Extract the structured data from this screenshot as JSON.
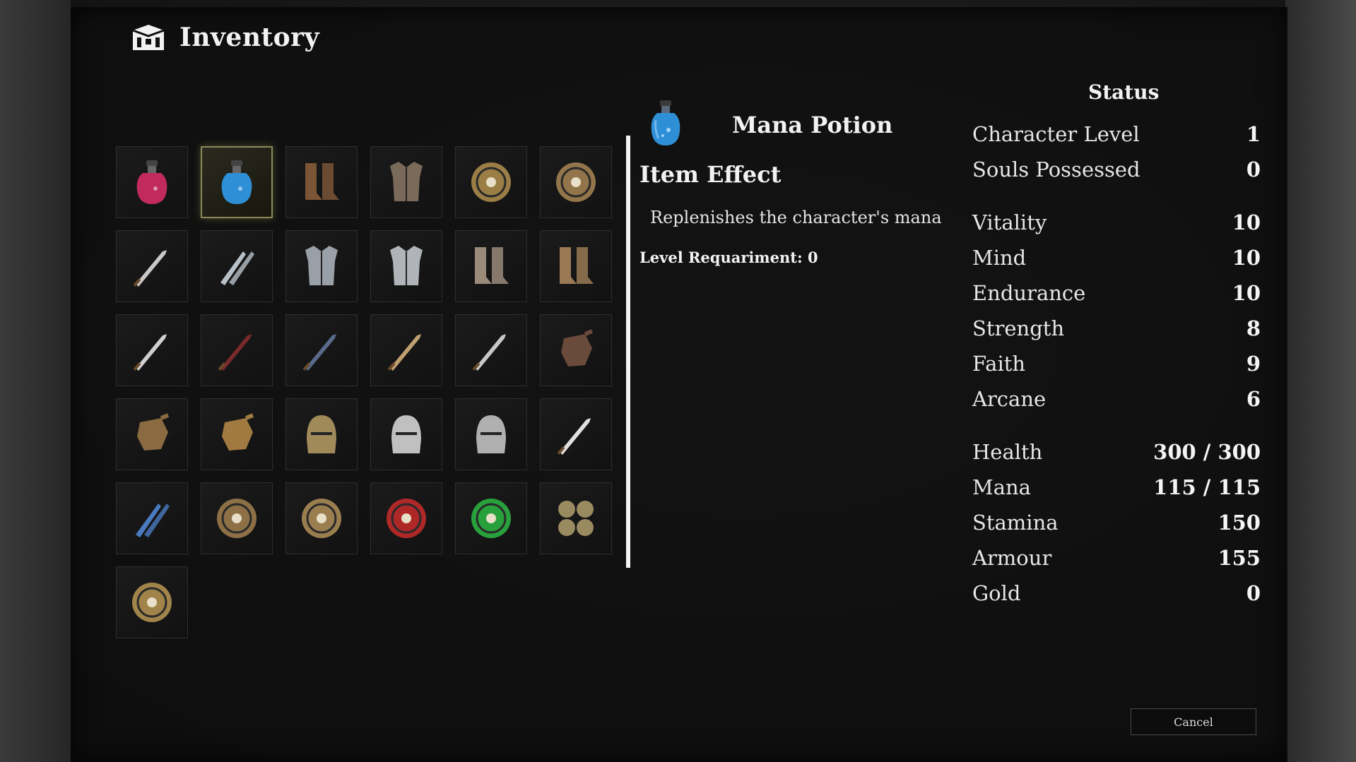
{
  "header": {
    "title": "Inventory",
    "icon": "chest-icon"
  },
  "inventory": {
    "selected_index": 1,
    "slots": [
      {
        "icon": "health-potion-icon",
        "color": "#c02a5c"
      },
      {
        "icon": "mana-potion-icon",
        "color": "#2f8fd6"
      },
      {
        "icon": "leather-boots-icon",
        "color": "#7a5536"
      },
      {
        "icon": "leather-chest-icon",
        "color": "#7a6a5a"
      },
      {
        "icon": "spiked-ring-icon",
        "color": "#a98a4a"
      },
      {
        "icon": "gem-shield-icon",
        "color": "#a08050"
      },
      {
        "icon": "curved-knife-icon",
        "color": "#c8c8c8"
      },
      {
        "icon": "twin-daggers-icon",
        "color": "#b8c0c8"
      },
      {
        "icon": "steel-cuirass-icon",
        "color": "#9aa0a8"
      },
      {
        "icon": "plate-armor-icon",
        "color": "#b0b4b8"
      },
      {
        "icon": "steel-greaves-icon",
        "color": "#9a8a7a"
      },
      {
        "icon": "fur-boots-icon",
        "color": "#9a7a55"
      },
      {
        "icon": "dagger-icon",
        "color": "#d0d0d0"
      },
      {
        "icon": "dark-dagger-icon",
        "color": "#7a2a2a"
      },
      {
        "icon": "blue-dagger-icon",
        "color": "#5a6a8a"
      },
      {
        "icon": "ornate-dagger-icon",
        "color": "#c0a070"
      },
      {
        "icon": "serrated-dagger-icon",
        "color": "#c8c8c8"
      },
      {
        "icon": "leather-gloves-icon",
        "color": "#6a4a3a"
      },
      {
        "icon": "dark-gauntlet-icon",
        "color": "#8a6a40"
      },
      {
        "icon": "gold-gauntlet-icon",
        "color": "#a07a40"
      },
      {
        "icon": "bronze-helm-icon",
        "color": "#a08a5a"
      },
      {
        "icon": "great-helm-icon",
        "color": "#c0c0c0"
      },
      {
        "icon": "knight-helm-icon",
        "color": "#b0b0b0"
      },
      {
        "icon": "longsword-icon",
        "color": "#e0e0e0"
      },
      {
        "icon": "ice-daggers-icon",
        "color": "#4a7ac0"
      },
      {
        "icon": "bronze-shield-icon",
        "color": "#9a7a4a"
      },
      {
        "icon": "pearl-amulet-icon",
        "color": "#a88a55"
      },
      {
        "icon": "ruby-amulet-icon",
        "color": "#c02a2a"
      },
      {
        "icon": "emerald-amulet-icon",
        "color": "#2ab040"
      },
      {
        "icon": "rune-coins-icon",
        "color": "#9a8a60"
      },
      {
        "icon": "sun-medallion-icon",
        "color": "#b09050"
      }
    ]
  },
  "item": {
    "name": "Mana Potion",
    "icon": "mana-potion-icon",
    "effect_title": "Item Effect",
    "effect_desc": "Replenishes the character's mana",
    "level_req": "Level Requariment: 0"
  },
  "status": {
    "title": "Status",
    "rows": [
      {
        "label": "Character Level",
        "value": "1"
      },
      {
        "label": "Souls Possessed",
        "value": "0"
      },
      {
        "label": "Vitality",
        "value": "10"
      },
      {
        "label": "Mind",
        "value": "10"
      },
      {
        "label": "Endurance",
        "value": "10"
      },
      {
        "label": "Strength",
        "value": "8"
      },
      {
        "label": "Faith",
        "value": "9"
      },
      {
        "label": "Arcane",
        "value": "6"
      },
      {
        "label": "Health",
        "value": "300 / 300"
      },
      {
        "label": "Mana",
        "value": "115 / 115"
      },
      {
        "label": "Stamina",
        "value": "150"
      },
      {
        "label": "Armour",
        "value": "155"
      },
      {
        "label": "Gold",
        "value": "0"
      }
    ]
  },
  "cancel_label": "Cancel"
}
